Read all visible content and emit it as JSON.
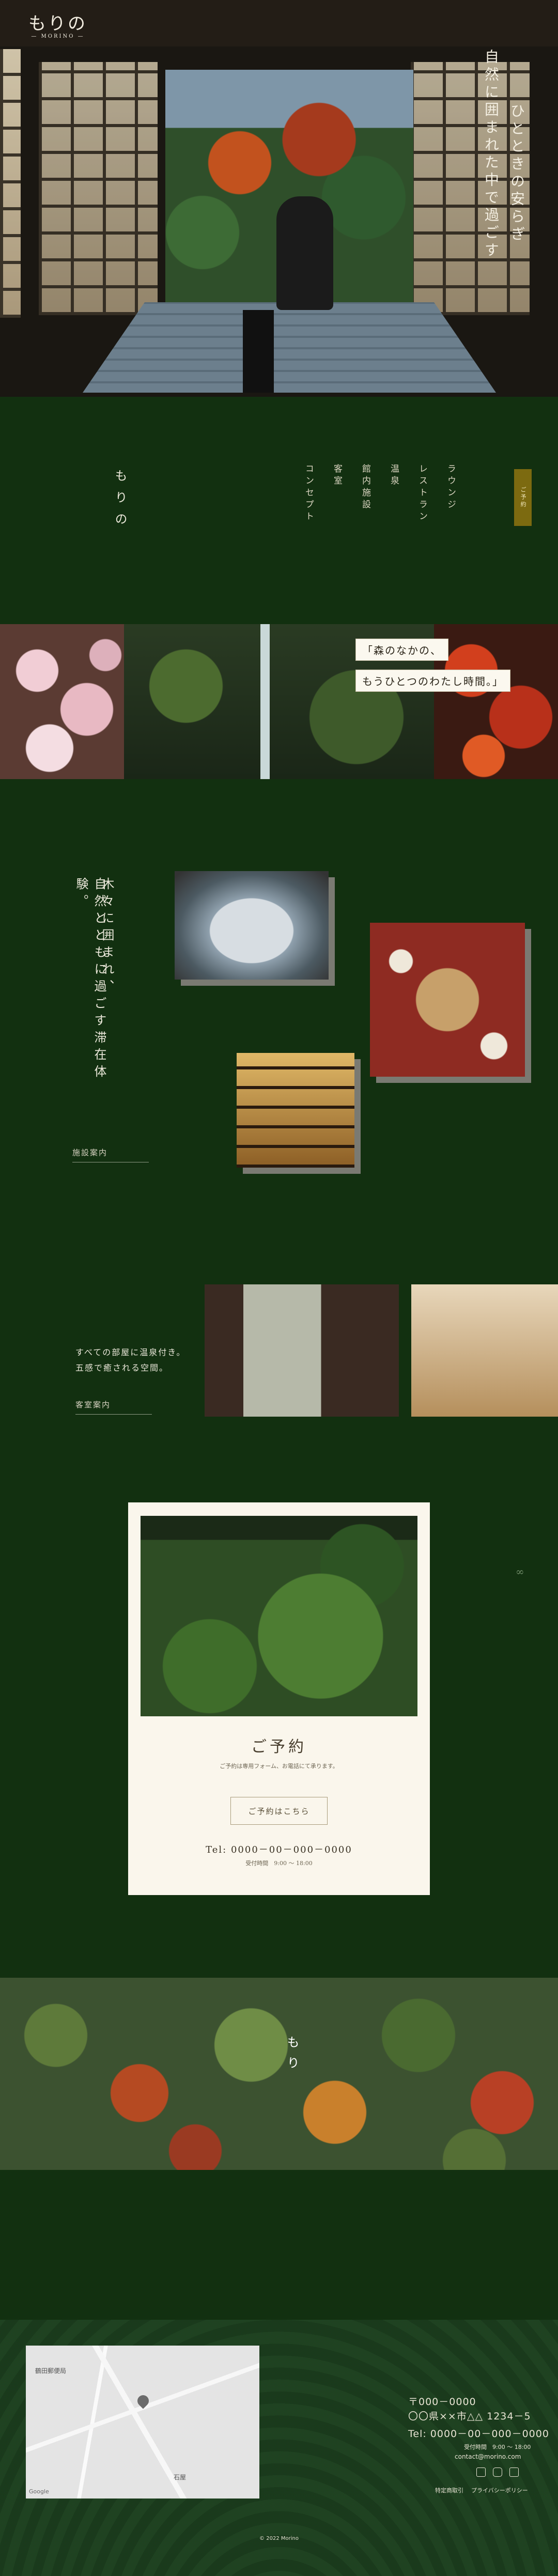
{
  "hero": {
    "brand_jp": "もりの",
    "brand_en": "— MORINO —",
    "tagline_1": "自然に囲まれた中で過ごす",
    "tagline_2": "ひとときの安らぎ"
  },
  "intro": {
    "logo_vertical": "もりの",
    "nav": [
      "コンセプト",
      "客室",
      "館内施設",
      "温泉",
      "レストラン",
      "ラウンジ"
    ],
    "reserve_badge": "ご予約"
  },
  "band": {
    "quote_1": "「森のなかの、",
    "quote_2": "もうひとつのわたし時間。」"
  },
  "facilities": {
    "heading_1": "木々に囲まれ、",
    "heading_2": "自然とともに過ごす滞在体験。",
    "link": "施設案内"
  },
  "rooms": {
    "text_1": "すべての部屋に温泉付き。",
    "text_2": "五感で癒される空間。",
    "link": "客室案内",
    "scroll_icon": "infinity-icon"
  },
  "reservation": {
    "title": "ご予約",
    "subtitle": "ご予約は専用フォーム、お電話にて承ります。",
    "button": "ご予約はこちら",
    "tel": "Tel: 0000－00－000－0000",
    "hours": "受付時間　9:00 ～ 18:00"
  },
  "forest": {
    "label": "もり"
  },
  "footer": {
    "map_label_1": "鶴田郵便局",
    "map_label_2": "石屋",
    "map_footer": "Google",
    "postal": "〒000－0000",
    "address": "〇〇県××市△△ 1234－5",
    "tel": "Tel: 0000－00－000－0000",
    "hours": "受付時間　9:00 ～ 18:00",
    "email": "contact@morino.com",
    "links_1": "特定商取引",
    "links_2": "プライバシーポリシー",
    "copyright": "© 2022 Morino"
  },
  "colors": {
    "bg": "#123010",
    "accent": "#7c6a10",
    "card": "#faf6ec"
  }
}
